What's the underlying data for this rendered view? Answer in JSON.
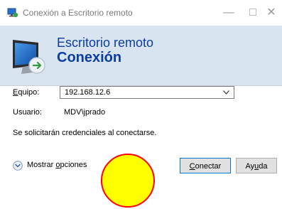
{
  "window": {
    "title": "Conexión a Escritorio remoto",
    "controls": [
      "—",
      "□",
      "✕"
    ]
  },
  "banner": {
    "line1": "Escritorio remoto",
    "line2": "Conexión",
    "background": "#d9e4f1",
    "text_color": "#0b3da0"
  },
  "form": {
    "computer_label_u": "E",
    "computer_label_rest": "quipo:",
    "computer_value": "192.168.12.6",
    "user_label": "Usuario:",
    "user_value": "MDV\\jprado",
    "info": "Se solicitarán credenciales al conectarse."
  },
  "footer": {
    "options_label_pre": "Mostrar ",
    "options_label_u": "o",
    "options_label_post": "pciones",
    "connect_u": "C",
    "connect_rest": "onectar",
    "help_pre": "Ay",
    "help_u": "u",
    "help_post": "da"
  },
  "overlay": {
    "fill": "#ffff00",
    "stroke": "#ff0000"
  },
  "icons": {
    "app": "remote-desktop-icon",
    "banner": "monitor-connection-icon",
    "options": "chevron-down-circle-icon",
    "combo": "dropdown-arrow-icon"
  }
}
